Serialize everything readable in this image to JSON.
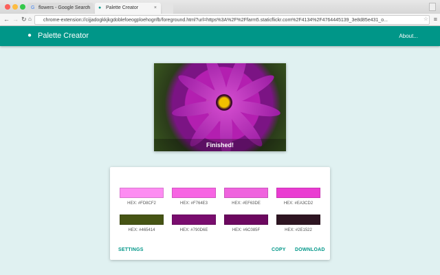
{
  "browser": {
    "tabs": [
      {
        "label": "flowers - Google Search",
        "close": "×"
      },
      {
        "label": "Palette Creator",
        "close": "×"
      }
    ],
    "url": "chrome-extension://cijjadogkkjkgdoblefoeogploehognfb/foreground.html?url=https%3A%2F%2Ffarm5.staticflickr.com%2F4134%2F4764445139_3e8d85e431_o..."
  },
  "header": {
    "title": "Palette Creator",
    "about": "About..."
  },
  "image": {
    "status": "Finished!"
  },
  "palette": {
    "swatches": [
      {
        "color": "#FD8CF2",
        "label": "HEX: #FD8CF2"
      },
      {
        "color": "#F764E3",
        "label": "HEX: #F764E3"
      },
      {
        "color": "#EF63DE",
        "label": "HEX: #EF63DE"
      },
      {
        "color": "#EA3CD2",
        "label": "HEX: #EA3CD2"
      },
      {
        "color": "#465414",
        "label": "HEX: #465414"
      },
      {
        "color": "#790D6E",
        "label": "HEX: #790D6E"
      },
      {
        "color": "#6C085F",
        "label": "HEX: #6C085F"
      },
      {
        "color": "#2E1522",
        "label": "HEX: #2E1522"
      }
    ]
  },
  "actions": {
    "settings": "SETTINGS",
    "copy": "COPY",
    "download": "DOWNLOAD"
  }
}
